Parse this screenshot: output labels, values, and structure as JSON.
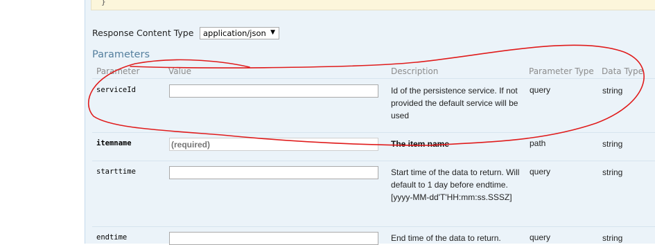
{
  "code_snippet": {
    "text": "}"
  },
  "response_content_type": {
    "label": "Response Content Type",
    "selected": "application/json"
  },
  "parameters": {
    "title": "Parameters",
    "headers": {
      "parameter": "Parameter",
      "value": "Value",
      "description": "Description",
      "parameter_type": "Parameter Type",
      "data_type": "Data Type"
    },
    "rows": [
      {
        "name": "serviceId",
        "value": "",
        "placeholder": "",
        "description": "Id of the persistence service. If not provided the default service will be used",
        "parameter_type": "query",
        "data_type": "string"
      },
      {
        "name": "itemname",
        "value": "",
        "placeholder": "(required)",
        "description": "The item name",
        "parameter_type": "path",
        "data_type": "string"
      },
      {
        "name": "starttime",
        "value": "",
        "placeholder": "",
        "description": "Start time of the data to return. Will default to 1 day before endtime. [yyyy-MM-dd'T'HH:mm:ss.SSSZ]",
        "parameter_type": "query",
        "data_type": "string"
      },
      {
        "name": "endtime",
        "value": "",
        "placeholder": "",
        "description": "End time of the data to return.",
        "parameter_type": "query",
        "data_type": "string"
      }
    ]
  },
  "annotation": {
    "color": "#e01b1b"
  }
}
